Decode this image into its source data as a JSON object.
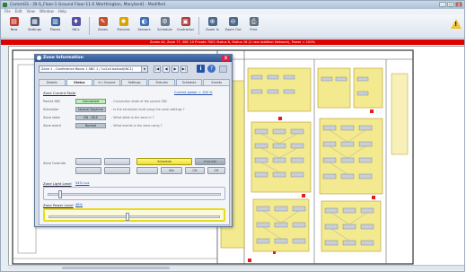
{
  "window": {
    "title": "CommGS - [B-S_Floor-1 Ground Floor-11-E Worthington, Maryland] - Modified",
    "menu": [
      "File",
      "Edit",
      "View",
      "Window",
      "Help"
    ],
    "minimize": "_",
    "maximize": "□",
    "close": "X"
  },
  "toolbar": {
    "buttons": [
      {
        "label": "New",
        "icon": "new-icon",
        "glyph": "▤",
        "color": "#c0392b"
      },
      {
        "label": "Settings",
        "icon": "settings-icon",
        "glyph": "▦",
        "color": "#4a5d7a"
      },
      {
        "label": "Places",
        "icon": "places-icon",
        "glyph": "▥",
        "color": "#3a5f9e"
      },
      {
        "label": "INCs",
        "icon": "incs-icon",
        "glyph": "♦",
        "color": "#5a4ea0"
      },
      {
        "label": "Zones",
        "icon": "zones-icon",
        "glyph": "✎",
        "color": "#c84f2d"
      },
      {
        "label": "Fixtures",
        "icon": "fixtures-icon",
        "glyph": "✹",
        "color": "#d9a400"
      },
      {
        "label": "Sensors",
        "icon": "sensors-icon",
        "glyph": "◐",
        "color": "#3f6fb5"
      },
      {
        "label": "Schedule",
        "icon": "schedule-icon",
        "glyph": "⚙",
        "color": "#6b7a8f"
      },
      {
        "label": "Contractor",
        "icon": "contractor-icon",
        "glyph": "▣",
        "color": "#b03a3a"
      },
      {
        "label": "Zoom In",
        "icon": "zoom-in-icon",
        "glyph": "⊕",
        "color": "#4c6a8c"
      },
      {
        "label": "Zoom Out",
        "icon": "zoom-out-icon",
        "glyph": "⊖",
        "color": "#4c6a8c"
      },
      {
        "label": "Print",
        "icon": "print-icon",
        "glyph": "⎙",
        "color": "#5e6f82"
      }
    ],
    "warning_glyph": "!"
  },
  "alert_bar": "Zones 44, Zone 77, SBC 10 Private 70E2 Status 6, Status 16 (2 new Addition Network), Power = 100%",
  "dialog": {
    "title": "Zone Information",
    "close": "X",
    "zone_select": "Zone 1 - Conference Room 1 SBC 1 / 1x2x4 ballast(INC1)",
    "zone_select_arrow": "▼",
    "nav": {
      "first": "|◀",
      "prev": "◀",
      "next": "▶",
      "last": "▶|"
    },
    "info_glyph": "i",
    "help_glyph": "?",
    "tabs": [
      "Details",
      "Status",
      "In / Ground",
      "Settings",
      "Fixtures",
      "Schedule",
      "Events"
    ],
    "active_tab": 1,
    "zone_state_title": "Zone Current State",
    "current_power_link": "Current power = 100 %",
    "fields": [
      {
        "label": "Parent SBC",
        "value": "Connected",
        "style": "green",
        "question": "- Connection state of the parent SBC"
      },
      {
        "label": "Scheduler",
        "value": "Normal Daytime",
        "style": "gray",
        "question": "- Is the scheduler built using the zone settings ?"
      },
      {
        "label": "Zone state",
        "value": "ON - IDLE",
        "style": "gray",
        "question": "- What state is the zone in ?"
      },
      {
        "label": "Zone event",
        "value": "Normal",
        "style": "gray",
        "question": "- What events is the zone using ?"
      }
    ],
    "side_label": "Zone Override",
    "buttons_left": [
      "",
      "",
      "",
      ""
    ],
    "buttons_right": [
      "Schedule",
      "Override",
      "",
      "Idle",
      "ON",
      "Off"
    ],
    "light_level_label": "Zone Light Level",
    "light_level_value": "54% Lux",
    "light_level_fraction": 0.06,
    "power_level_label": "Zone Power Level",
    "power_level_value": "48%",
    "power_level_fraction": 0.44
  }
}
